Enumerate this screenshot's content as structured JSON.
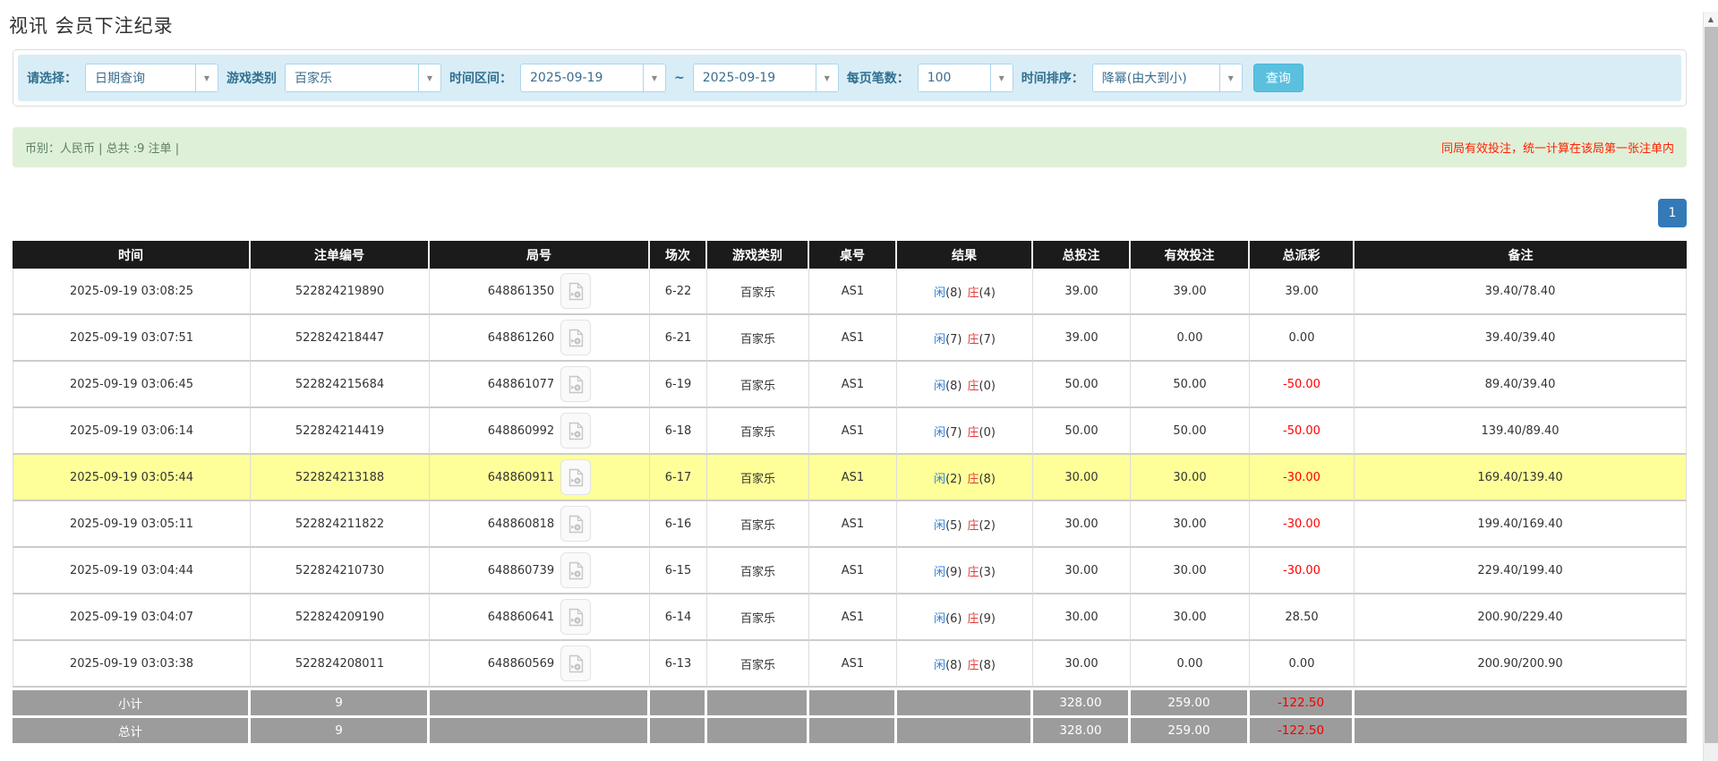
{
  "page": {
    "title": "视讯 会员下注纪录"
  },
  "filters": {
    "select_label": "请选择：",
    "select_value": "日期查询",
    "game_type_label": "游戏类别",
    "game_type_value": "百家乐",
    "time_range_label": "时间区间：",
    "date_from": "2025-09-19",
    "date_separator": "~",
    "date_to": "2025-09-19",
    "page_size_label": "每页笔数：",
    "page_size_value": "100",
    "sort_label": "时间排序：",
    "sort_value": "降幂(由大到小)",
    "search_button": "查询"
  },
  "summary": {
    "left_text": "币别：人民币 | 总共 :9 注单 |",
    "right_notice": "同局有效投注，统一计算在该局第一张注单内"
  },
  "pagination": {
    "current_page": "1"
  },
  "table": {
    "headers": [
      "时间",
      "注单编号",
      "局号",
      "场次",
      "游戏类别",
      "桌号",
      "结果",
      "总投注",
      "有效投注",
      "总派彩",
      "备注"
    ],
    "rows": [
      {
        "time": "2025-09-19 03:08:25",
        "bet_no": "522824219890",
        "round_no": "648861350",
        "session": "6-22",
        "game": "百家乐",
        "table_no": "AS1",
        "result": {
          "player_label": "闲",
          "player_num": "(8)",
          "banker_label": "庄",
          "banker_num": "(4)"
        },
        "total_bet": "39.00",
        "valid_bet": "39.00",
        "payout": "39.00",
        "remark": "39.40/78.40",
        "highlight": false
      },
      {
        "time": "2025-09-19 03:07:51",
        "bet_no": "522824218447",
        "round_no": "648861260",
        "session": "6-21",
        "game": "百家乐",
        "table_no": "AS1",
        "result": {
          "player_label": "闲",
          "player_num": "(7)",
          "banker_label": "庄",
          "banker_num": "(7)"
        },
        "total_bet": "39.00",
        "valid_bet": "0.00",
        "payout": "0.00",
        "remark": "39.40/39.40",
        "highlight": false
      },
      {
        "time": "2025-09-19 03:06:45",
        "bet_no": "522824215684",
        "round_no": "648861077",
        "session": "6-19",
        "game": "百家乐",
        "table_no": "AS1",
        "result": {
          "player_label": "闲",
          "player_num": "(8)",
          "banker_label": "庄",
          "banker_num": "(0)"
        },
        "total_bet": "50.00",
        "valid_bet": "50.00",
        "payout": "-50.00",
        "remark": "89.40/39.40",
        "highlight": false
      },
      {
        "time": "2025-09-19 03:06:14",
        "bet_no": "522824214419",
        "round_no": "648860992",
        "session": "6-18",
        "game": "百家乐",
        "table_no": "AS1",
        "result": {
          "player_label": "闲",
          "player_num": "(7)",
          "banker_label": "庄",
          "banker_num": "(0)"
        },
        "total_bet": "50.00",
        "valid_bet": "50.00",
        "payout": "-50.00",
        "remark": "139.40/89.40",
        "highlight": false
      },
      {
        "time": "2025-09-19 03:05:44",
        "bet_no": "522824213188",
        "round_no": "648860911",
        "session": "6-17",
        "game": "百家乐",
        "table_no": "AS1",
        "result": {
          "player_label": "闲",
          "player_num": "(2)",
          "banker_label": "庄",
          "banker_num": "(8)"
        },
        "total_bet": "30.00",
        "valid_bet": "30.00",
        "payout": "-30.00",
        "remark": "169.40/139.40",
        "highlight": true
      },
      {
        "time": "2025-09-19 03:05:11",
        "bet_no": "522824211822",
        "round_no": "648860818",
        "session": "6-16",
        "game": "百家乐",
        "table_no": "AS1",
        "result": {
          "player_label": "闲",
          "player_num": "(5)",
          "banker_label": "庄",
          "banker_num": "(2)"
        },
        "total_bet": "30.00",
        "valid_bet": "30.00",
        "payout": "-30.00",
        "remark": "199.40/169.40",
        "highlight": false
      },
      {
        "time": "2025-09-19 03:04:44",
        "bet_no": "522824210730",
        "round_no": "648860739",
        "session": "6-15",
        "game": "百家乐",
        "table_no": "AS1",
        "result": {
          "player_label": "闲",
          "player_num": "(9)",
          "banker_label": "庄",
          "banker_num": "(3)"
        },
        "total_bet": "30.00",
        "valid_bet": "30.00",
        "payout": "-30.00",
        "remark": "229.40/199.40",
        "highlight": false
      },
      {
        "time": "2025-09-19 03:04:07",
        "bet_no": "522824209190",
        "round_no": "648860641",
        "session": "6-14",
        "game": "百家乐",
        "table_no": "AS1",
        "result": {
          "player_label": "闲",
          "player_num": "(6)",
          "banker_label": "庄",
          "banker_num": "(9)"
        },
        "total_bet": "30.00",
        "valid_bet": "30.00",
        "payout": "28.50",
        "remark": "200.90/229.40",
        "highlight": false
      },
      {
        "time": "2025-09-19 03:03:38",
        "bet_no": "522824208011",
        "round_no": "648860569",
        "session": "6-13",
        "game": "百家乐",
        "table_no": "AS1",
        "result": {
          "player_label": "闲",
          "player_num": "(8)",
          "banker_label": "庄",
          "banker_num": "(8)"
        },
        "total_bet": "30.00",
        "valid_bet": "0.00",
        "payout": "0.00",
        "remark": "200.90/200.90",
        "highlight": false
      }
    ],
    "footer_rows": [
      {
        "label": "小计",
        "count": "9",
        "total_bet": "328.00",
        "valid_bet": "259.00",
        "payout": "-122.50"
      },
      {
        "label": "总计",
        "count": "9",
        "total_bet": "328.00",
        "valid_bet": "259.00",
        "payout": "-122.50"
      }
    ]
  },
  "colors": {
    "accent_button": "#5bc0de",
    "pagination_blue": "#337ab7",
    "player_blue": "#2f7ed8",
    "banker_red": "#e03c3c",
    "negative_red": "#ff0000",
    "highlight_yellow": "#ffff99",
    "header_bg": "#1b1b1b",
    "footer_gray": "#9c9c9c",
    "filter_bg": "#d9edf7",
    "summary_bg": "#dff0d8"
  }
}
